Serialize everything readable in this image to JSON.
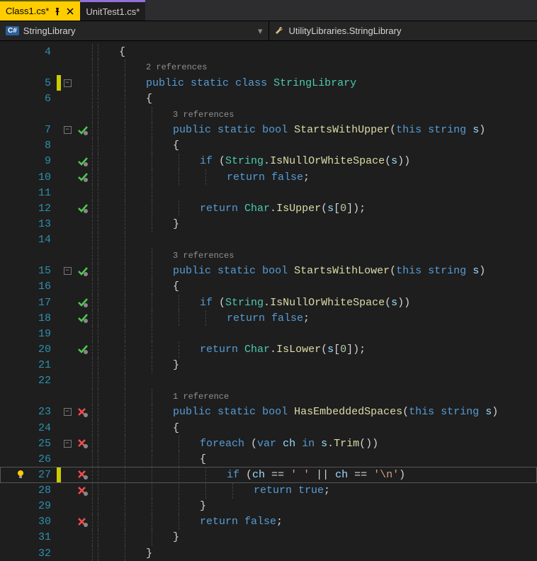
{
  "tabs": [
    {
      "label": "Class1.cs*",
      "active": true,
      "pinned": true
    },
    {
      "label": "UnitTest1.cs*",
      "active": false,
      "pinned": false
    }
  ],
  "nav": {
    "left": "StringLibrary",
    "right": "UtilityLibraries.StringLibrary",
    "badge": "C#"
  },
  "codelens": {
    "class": "2 references",
    "upper": "3 references",
    "lower": "3 references",
    "embedded": "1 reference"
  },
  "lines": [
    {
      "n": 4,
      "indent": 1,
      "tokens": [
        {
          "t": "{",
          "c": "brace"
        }
      ]
    },
    {
      "n": null,
      "indent": 2,
      "codelens": "class"
    },
    {
      "n": 5,
      "indent": 2,
      "fold": true,
      "changed": true,
      "tokens": [
        {
          "t": "public",
          "c": "kw"
        },
        {
          "t": " "
        },
        {
          "t": "static",
          "c": "kw"
        },
        {
          "t": " "
        },
        {
          "t": "class",
          "c": "kw"
        },
        {
          "t": " "
        },
        {
          "t": "StringLibrary",
          "c": "type"
        }
      ]
    },
    {
      "n": 6,
      "indent": 2,
      "tokens": [
        {
          "t": "{",
          "c": "brace"
        }
      ]
    },
    {
      "n": null,
      "indent": 3,
      "codelens": "upper"
    },
    {
      "n": 7,
      "indent": 3,
      "fold": true,
      "test": "pass",
      "tokens": [
        {
          "t": "public",
          "c": "kw"
        },
        {
          "t": " "
        },
        {
          "t": "static",
          "c": "kw"
        },
        {
          "t": " "
        },
        {
          "t": "bool",
          "c": "kw"
        },
        {
          "t": " "
        },
        {
          "t": "StartsWithUpper",
          "c": "method"
        },
        {
          "t": "("
        },
        {
          "t": "this",
          "c": "kw"
        },
        {
          "t": " "
        },
        {
          "t": "string",
          "c": "kw"
        },
        {
          "t": " "
        },
        {
          "t": "s",
          "c": "param"
        },
        {
          "t": ")"
        }
      ]
    },
    {
      "n": 8,
      "indent": 3,
      "tokens": [
        {
          "t": "{",
          "c": "brace"
        }
      ]
    },
    {
      "n": 9,
      "indent": 4,
      "test": "pass",
      "tokens": [
        {
          "t": "if",
          "c": "kw"
        },
        {
          "t": " ("
        },
        {
          "t": "String",
          "c": "type"
        },
        {
          "t": "."
        },
        {
          "t": "IsNullOrWhiteSpace",
          "c": "method"
        },
        {
          "t": "("
        },
        {
          "t": "s",
          "c": "param"
        },
        {
          "t": "))"
        }
      ]
    },
    {
      "n": 10,
      "indent": 5,
      "test": "pass",
      "tokens": [
        {
          "t": "return",
          "c": "kw"
        },
        {
          "t": " "
        },
        {
          "t": "false",
          "c": "kw"
        },
        {
          "t": ";"
        }
      ]
    },
    {
      "n": 11,
      "indent": 3,
      "tokens": []
    },
    {
      "n": 12,
      "indent": 4,
      "test": "pass",
      "tokens": [
        {
          "t": "return",
          "c": "kw"
        },
        {
          "t": " "
        },
        {
          "t": "Char",
          "c": "type"
        },
        {
          "t": "."
        },
        {
          "t": "IsUpper",
          "c": "method"
        },
        {
          "t": "("
        },
        {
          "t": "s",
          "c": "param"
        },
        {
          "t": "["
        },
        {
          "t": "0",
          "c": "num"
        },
        {
          "t": "]);"
        }
      ]
    },
    {
      "n": 13,
      "indent": 3,
      "tokens": [
        {
          "t": "}",
          "c": "brace"
        }
      ]
    },
    {
      "n": 14,
      "indent": 2,
      "tokens": []
    },
    {
      "n": null,
      "indent": 3,
      "codelens": "lower"
    },
    {
      "n": 15,
      "indent": 3,
      "fold": true,
      "test": "pass",
      "tokens": [
        {
          "t": "public",
          "c": "kw"
        },
        {
          "t": " "
        },
        {
          "t": "static",
          "c": "kw"
        },
        {
          "t": " "
        },
        {
          "t": "bool",
          "c": "kw"
        },
        {
          "t": " "
        },
        {
          "t": "StartsWithLower",
          "c": "method"
        },
        {
          "t": "("
        },
        {
          "t": "this",
          "c": "kw"
        },
        {
          "t": " "
        },
        {
          "t": "string",
          "c": "kw"
        },
        {
          "t": " "
        },
        {
          "t": "s",
          "c": "param"
        },
        {
          "t": ")"
        }
      ]
    },
    {
      "n": 16,
      "indent": 3,
      "tokens": [
        {
          "t": "{",
          "c": "brace"
        }
      ]
    },
    {
      "n": 17,
      "indent": 4,
      "test": "pass",
      "tokens": [
        {
          "t": "if",
          "c": "kw"
        },
        {
          "t": " ("
        },
        {
          "t": "String",
          "c": "type"
        },
        {
          "t": "."
        },
        {
          "t": "IsNullOrWhiteSpace",
          "c": "method"
        },
        {
          "t": "("
        },
        {
          "t": "s",
          "c": "param"
        },
        {
          "t": "))"
        }
      ]
    },
    {
      "n": 18,
      "indent": 5,
      "test": "pass",
      "tokens": [
        {
          "t": "return",
          "c": "kw"
        },
        {
          "t": " "
        },
        {
          "t": "false",
          "c": "kw"
        },
        {
          "t": ";"
        }
      ]
    },
    {
      "n": 19,
      "indent": 3,
      "tokens": []
    },
    {
      "n": 20,
      "indent": 4,
      "test": "pass",
      "tokens": [
        {
          "t": "return",
          "c": "kw"
        },
        {
          "t": " "
        },
        {
          "t": "Char",
          "c": "type"
        },
        {
          "t": "."
        },
        {
          "t": "IsLower",
          "c": "method"
        },
        {
          "t": "("
        },
        {
          "t": "s",
          "c": "param"
        },
        {
          "t": "["
        },
        {
          "t": "0",
          "c": "num"
        },
        {
          "t": "]);"
        }
      ]
    },
    {
      "n": 21,
      "indent": 3,
      "tokens": [
        {
          "t": "}",
          "c": "brace"
        }
      ]
    },
    {
      "n": 22,
      "indent": 2,
      "tokens": []
    },
    {
      "n": null,
      "indent": 3,
      "codelens": "embedded"
    },
    {
      "n": 23,
      "indent": 3,
      "fold": true,
      "test": "fail",
      "tokens": [
        {
          "t": "public",
          "c": "kw"
        },
        {
          "t": " "
        },
        {
          "t": "static",
          "c": "kw"
        },
        {
          "t": " "
        },
        {
          "t": "bool",
          "c": "kw"
        },
        {
          "t": " "
        },
        {
          "t": "HasEmbeddedSpaces",
          "c": "method"
        },
        {
          "t": "("
        },
        {
          "t": "this",
          "c": "kw"
        },
        {
          "t": " "
        },
        {
          "t": "string",
          "c": "kw"
        },
        {
          "t": " "
        },
        {
          "t": "s",
          "c": "param"
        },
        {
          "t": ")"
        }
      ]
    },
    {
      "n": 24,
      "indent": 3,
      "tokens": [
        {
          "t": "{",
          "c": "brace"
        }
      ]
    },
    {
      "n": 25,
      "indent": 4,
      "fold": true,
      "test": "fail",
      "tokens": [
        {
          "t": "foreach",
          "c": "kw"
        },
        {
          "t": " ("
        },
        {
          "t": "var",
          "c": "kw"
        },
        {
          "t": " "
        },
        {
          "t": "ch",
          "c": "param"
        },
        {
          "t": " "
        },
        {
          "t": "in",
          "c": "kw"
        },
        {
          "t": " "
        },
        {
          "t": "s",
          "c": "param"
        },
        {
          "t": "."
        },
        {
          "t": "Trim",
          "c": "method"
        },
        {
          "t": "())"
        }
      ]
    },
    {
      "n": 26,
      "indent": 4,
      "tokens": [
        {
          "t": "{",
          "c": "brace"
        }
      ]
    },
    {
      "n": 27,
      "indent": 5,
      "test": "fail",
      "changed": true,
      "lightbulb": true,
      "highlight": true,
      "tokens": [
        {
          "t": "if",
          "c": "kw"
        },
        {
          "t": " ("
        },
        {
          "t": "ch",
          "c": "param"
        },
        {
          "t": " == "
        },
        {
          "t": "' '",
          "c": "str"
        },
        {
          "t": " || "
        },
        {
          "t": "ch",
          "c": "param"
        },
        {
          "t": " == "
        },
        {
          "t": "'\\n'",
          "c": "str"
        },
        {
          "t": ")"
        }
      ]
    },
    {
      "n": 28,
      "indent": 6,
      "test": "fail",
      "tokens": [
        {
          "t": "return",
          "c": "kw"
        },
        {
          "t": " "
        },
        {
          "t": "true",
          "c": "kw"
        },
        {
          "t": ";"
        }
      ]
    },
    {
      "n": 29,
      "indent": 4,
      "tokens": [
        {
          "t": "}",
          "c": "brace"
        }
      ]
    },
    {
      "n": 30,
      "indent": 4,
      "test": "fail",
      "tokens": [
        {
          "t": "return",
          "c": "kw"
        },
        {
          "t": " "
        },
        {
          "t": "false",
          "c": "kw"
        },
        {
          "t": ";"
        }
      ]
    },
    {
      "n": 31,
      "indent": 3,
      "tokens": [
        {
          "t": "}",
          "c": "brace"
        }
      ]
    },
    {
      "n": 32,
      "indent": 2,
      "tokens": [
        {
          "t": "}",
          "c": "brace"
        }
      ]
    }
  ]
}
